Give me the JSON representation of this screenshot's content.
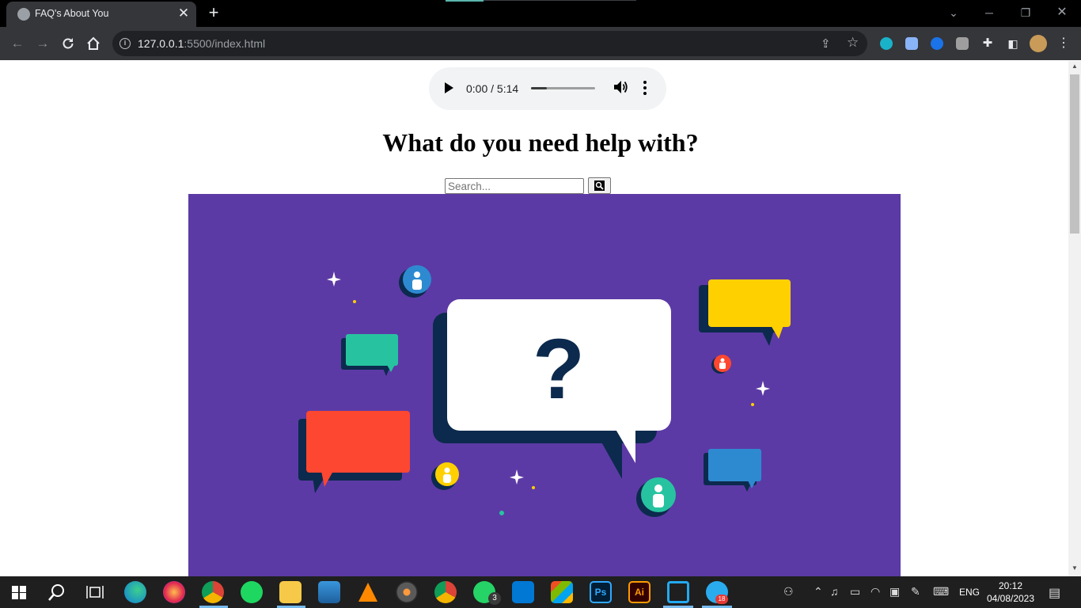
{
  "browser": {
    "tab_title": "FAQ's About You",
    "tab_close": "✕",
    "new_tab": "+",
    "url_host": "127.0.0.1",
    "url_rest": ":5500/index.html"
  },
  "page": {
    "audio": {
      "time": "0:00 / 5:14",
      "progress_fraction": 0.25
    },
    "heading": "What do you need help with?",
    "search": {
      "placeholder": "Search..."
    }
  },
  "hero": {
    "question_mark": "?",
    "colors": {
      "background": "#5c3aa5",
      "bubble_main": "#ffffff",
      "bubble_shadow": "#0c2a4d",
      "yellow": "#ffd000",
      "teal": "#27c3a0",
      "red": "#fd4730",
      "blue": "#2e8ad0"
    }
  },
  "taskbar": {
    "language": "ENG",
    "time": "20:12",
    "date": "04/08/2023",
    "whatsapp_badge": "3",
    "telegram_badge": "18"
  }
}
